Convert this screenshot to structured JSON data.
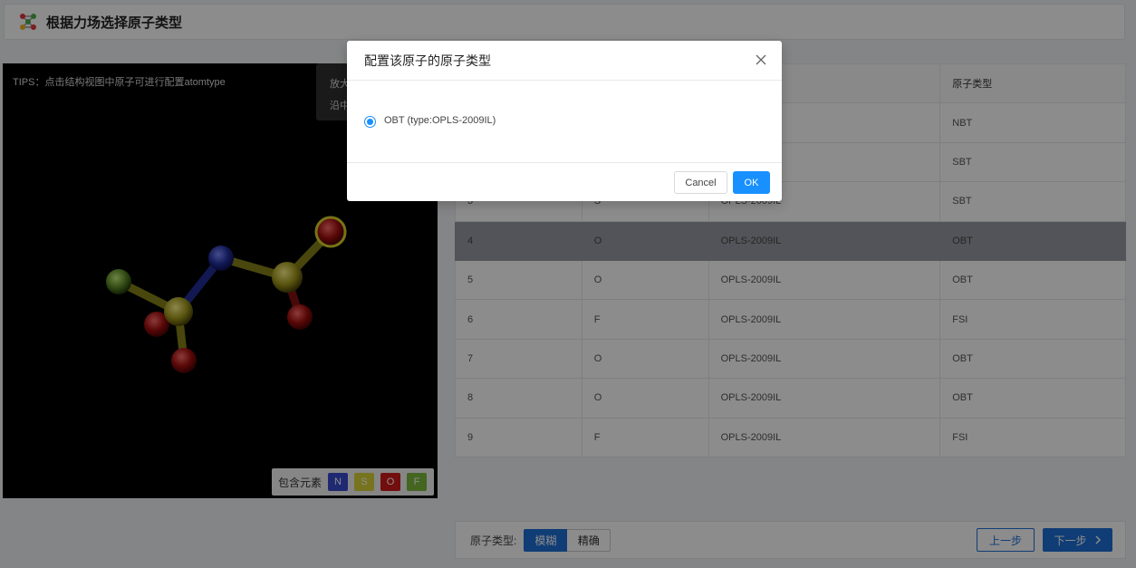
{
  "header": {
    "title": "根据力场选择原子类型",
    "logo_icon": "molecule-logo-icon"
  },
  "viewer": {
    "tips": "TIPS：点击结构视图中原子可进行配置atomtype",
    "help_line1": "放大",
    "help_line2": "沿中",
    "legend_label": "包含元素",
    "elements": [
      {
        "symbol": "N",
        "color": "#3a4bd0"
      },
      {
        "symbol": "S",
        "color": "#d9d33a"
      },
      {
        "symbol": "O",
        "color": "#d11a1a"
      },
      {
        "symbol": "F",
        "color": "#7cba3c"
      }
    ]
  },
  "table": {
    "headers": [
      "",
      "",
      "",
      "原子类型"
    ],
    "rows": [
      {
        "idx": "",
        "elem": "",
        "ff": "",
        "type": "NBT"
      },
      {
        "idx": "",
        "elem": "",
        "ff": "",
        "type": "SBT"
      },
      {
        "idx": "3",
        "elem": "S",
        "ff": "OPLS-2009IL",
        "type": "SBT"
      },
      {
        "idx": "4",
        "elem": "O",
        "ff": "OPLS-2009IL",
        "type": "OBT",
        "selected": true
      },
      {
        "idx": "5",
        "elem": "O",
        "ff": "OPLS-2009IL",
        "type": "OBT"
      },
      {
        "idx": "6",
        "elem": "F",
        "ff": "OPLS-2009IL",
        "type": "FSI"
      },
      {
        "idx": "7",
        "elem": "O",
        "ff": "OPLS-2009IL",
        "type": "OBT"
      },
      {
        "idx": "8",
        "elem": "O",
        "ff": "OPLS-2009IL",
        "type": "OBT"
      },
      {
        "idx": "9",
        "elem": "F",
        "ff": "OPLS-2009IL",
        "type": "FSI"
      }
    ]
  },
  "footer": {
    "atom_type_label": "原子类型:",
    "mode_fuzzy": "模糊",
    "mode_exact": "精确",
    "prev": "上一步",
    "next": "下一步"
  },
  "modal": {
    "title": "配置该原子的原子类型",
    "option_label": "OBT  (type:OPLS-2009IL)",
    "cancel": "Cancel",
    "ok": "OK"
  }
}
